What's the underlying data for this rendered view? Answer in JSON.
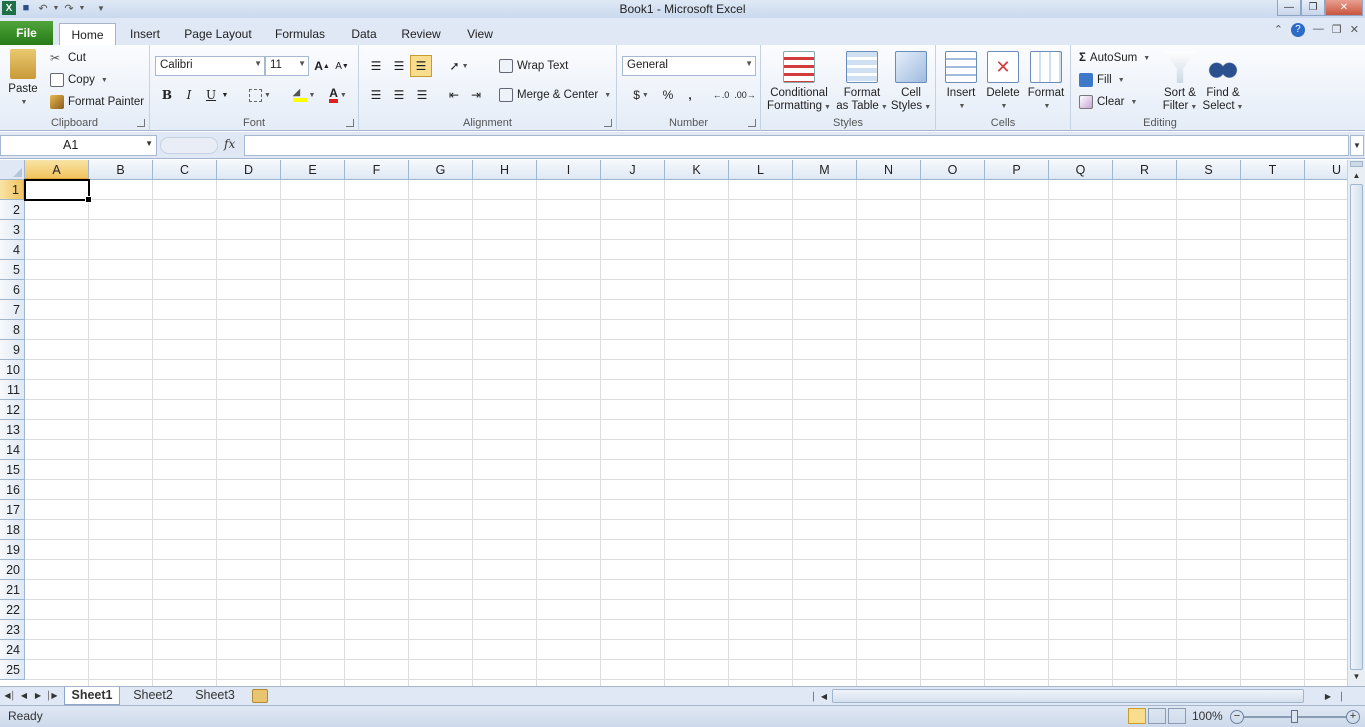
{
  "window": {
    "title": "Book1  -  Microsoft Excel"
  },
  "ribbon_tabs": [
    {
      "label": "File"
    },
    {
      "label": "Home"
    },
    {
      "label": "Insert"
    },
    {
      "label": "Page Layout"
    },
    {
      "label": "Formulas"
    },
    {
      "label": "Data"
    },
    {
      "label": "Review"
    },
    {
      "label": "View"
    }
  ],
  "clipboard": {
    "paste": "Paste",
    "cut": "Cut",
    "copy": "Copy",
    "format_painter": "Format Painter",
    "label": "Clipboard"
  },
  "font": {
    "name": "Calibri",
    "size": "11",
    "bold": "B",
    "italic": "I",
    "underline": "U",
    "label": "Font"
  },
  "alignment": {
    "wrap_text": "Wrap Text",
    "merge_center": "Merge & Center",
    "label": "Alignment"
  },
  "number": {
    "format": "General",
    "currency": "$",
    "percent": "%",
    "comma": ",",
    "label": "Number"
  },
  "styles": {
    "conditional_1": "Conditional",
    "conditional_2": "Formatting",
    "format_table_1": "Format",
    "format_table_2": "as Table",
    "cell_styles_1": "Cell",
    "cell_styles_2": "Styles",
    "label": "Styles"
  },
  "cells_group": {
    "insert": "Insert",
    "delete": "Delete",
    "format": "Format",
    "label": "Cells"
  },
  "editing": {
    "autosum": "AutoSum",
    "fill": "Fill",
    "clear": "Clear",
    "sort_1": "Sort &",
    "sort_2": "Filter",
    "find_1": "Find &",
    "find_2": "Select",
    "label": "Editing"
  },
  "formula_bar": {
    "name_box": "A1",
    "fx": "fx",
    "value": ""
  },
  "grid": {
    "columns": [
      "A",
      "B",
      "C",
      "D",
      "E",
      "F",
      "G",
      "H",
      "I",
      "J",
      "K",
      "L",
      "M",
      "N",
      "O",
      "P",
      "Q",
      "R",
      "S",
      "T",
      "U"
    ],
    "rows": [
      "1",
      "2",
      "3",
      "4",
      "5",
      "6",
      "7",
      "8",
      "9",
      "10",
      "11",
      "12",
      "13",
      "14",
      "15",
      "16",
      "17",
      "18",
      "19",
      "20",
      "21",
      "22",
      "23",
      "24",
      "25"
    ],
    "active_cell": "A1"
  },
  "sheets": [
    {
      "label": "Sheet1",
      "active": true
    },
    {
      "label": "Sheet2"
    },
    {
      "label": "Sheet3"
    }
  ],
  "status": {
    "text": "Ready",
    "zoom": "100%",
    "zoom_minus": "−",
    "zoom_plus": "+"
  },
  "colors": {
    "file_tab": "#2f8a1f",
    "selected_header": "#f1c35e",
    "gridline": "#dadcdd",
    "ribbon_bg": "#dfe8f4"
  }
}
